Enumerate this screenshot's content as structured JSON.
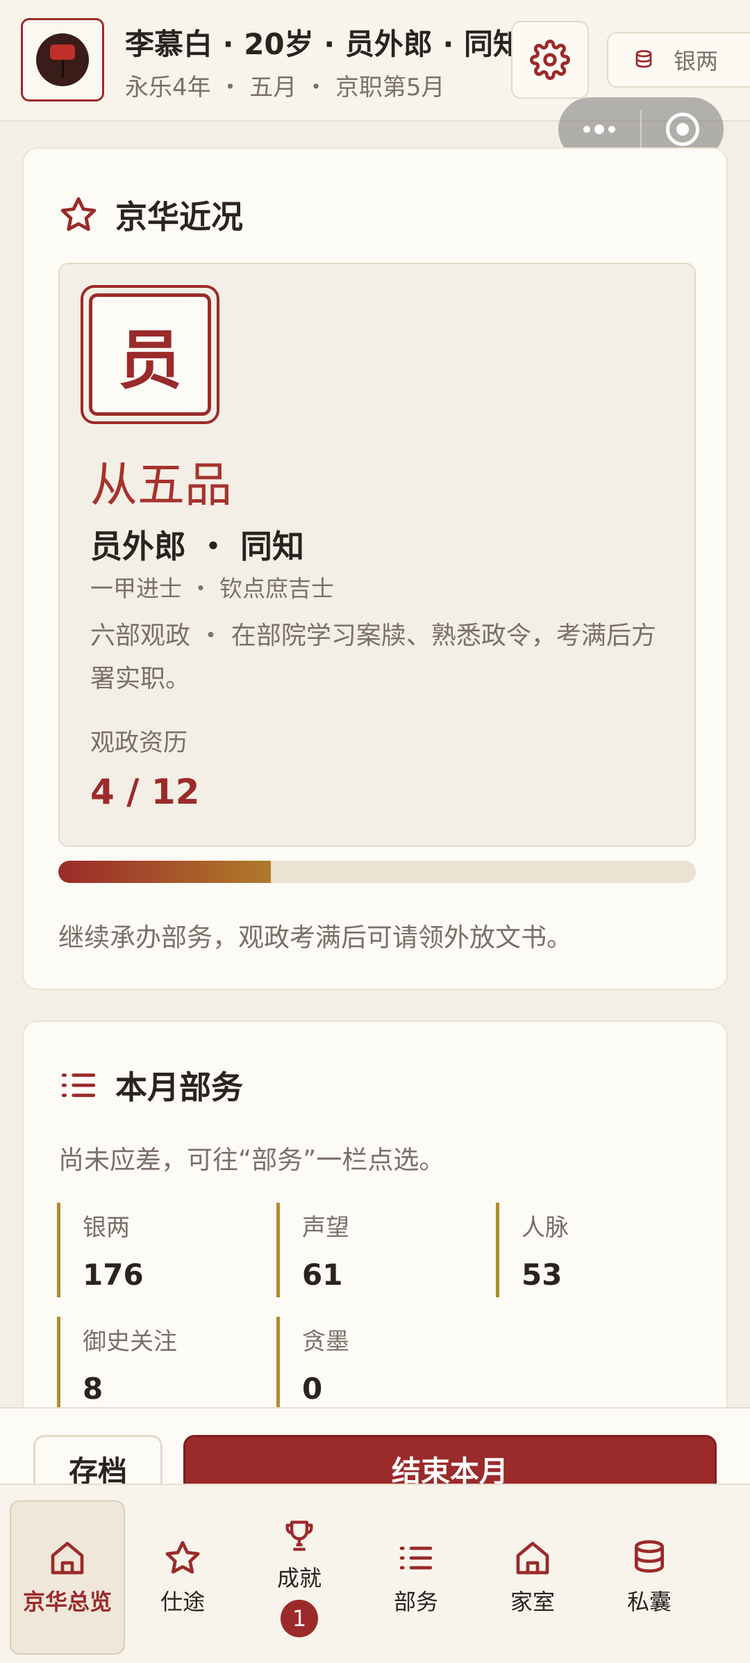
{
  "header": {
    "title": "李慕白 · 20岁 · 员外郎 · 同知",
    "subtitle": "永乐4年 ・ 五月 ・ 京职第5月",
    "money_label": "银两"
  },
  "card1": {
    "title": "京华近况",
    "seal_char": "员",
    "grade": "从五品",
    "position": "员外郎 ・ 同知",
    "origin": "一甲进士 ・ 钦点庶吉士",
    "description": "六部观政 ・ 在部院学习案牍、熟悉政令，考满后方署实职。",
    "exp_label": "观政资历",
    "exp_value": "4 / 12",
    "exp_progress": 0.333,
    "hint": "继续承办部务，观政考满后可请领外放文书。"
  },
  "card2": {
    "title": "本月部务",
    "note": "尚未应差，可往“部务”一栏点选。",
    "stats": [
      {
        "label": "银两",
        "value": "176"
      },
      {
        "label": "声望",
        "value": "61"
      },
      {
        "label": "人脉",
        "value": "53"
      },
      {
        "label": "御史关注",
        "value": "8"
      },
      {
        "label": "贪墨",
        "value": "0"
      }
    ]
  },
  "actions": {
    "save": "存档",
    "end_month": "结束本月"
  },
  "tabs": [
    {
      "label": "京华总览",
      "icon": "home-icon",
      "active": true
    },
    {
      "label": "仕途",
      "icon": "star-icon"
    },
    {
      "label": "成就",
      "icon": "trophy-icon",
      "badge": "1"
    },
    {
      "label": "部务",
      "icon": "list-icon"
    },
    {
      "label": "家室",
      "icon": "home-icon"
    },
    {
      "label": "私囊",
      "icon": "coins-icon"
    }
  ],
  "colors": {
    "accent": "#9b2a2a",
    "gold": "#b08a32",
    "background": "#f4efe6"
  }
}
